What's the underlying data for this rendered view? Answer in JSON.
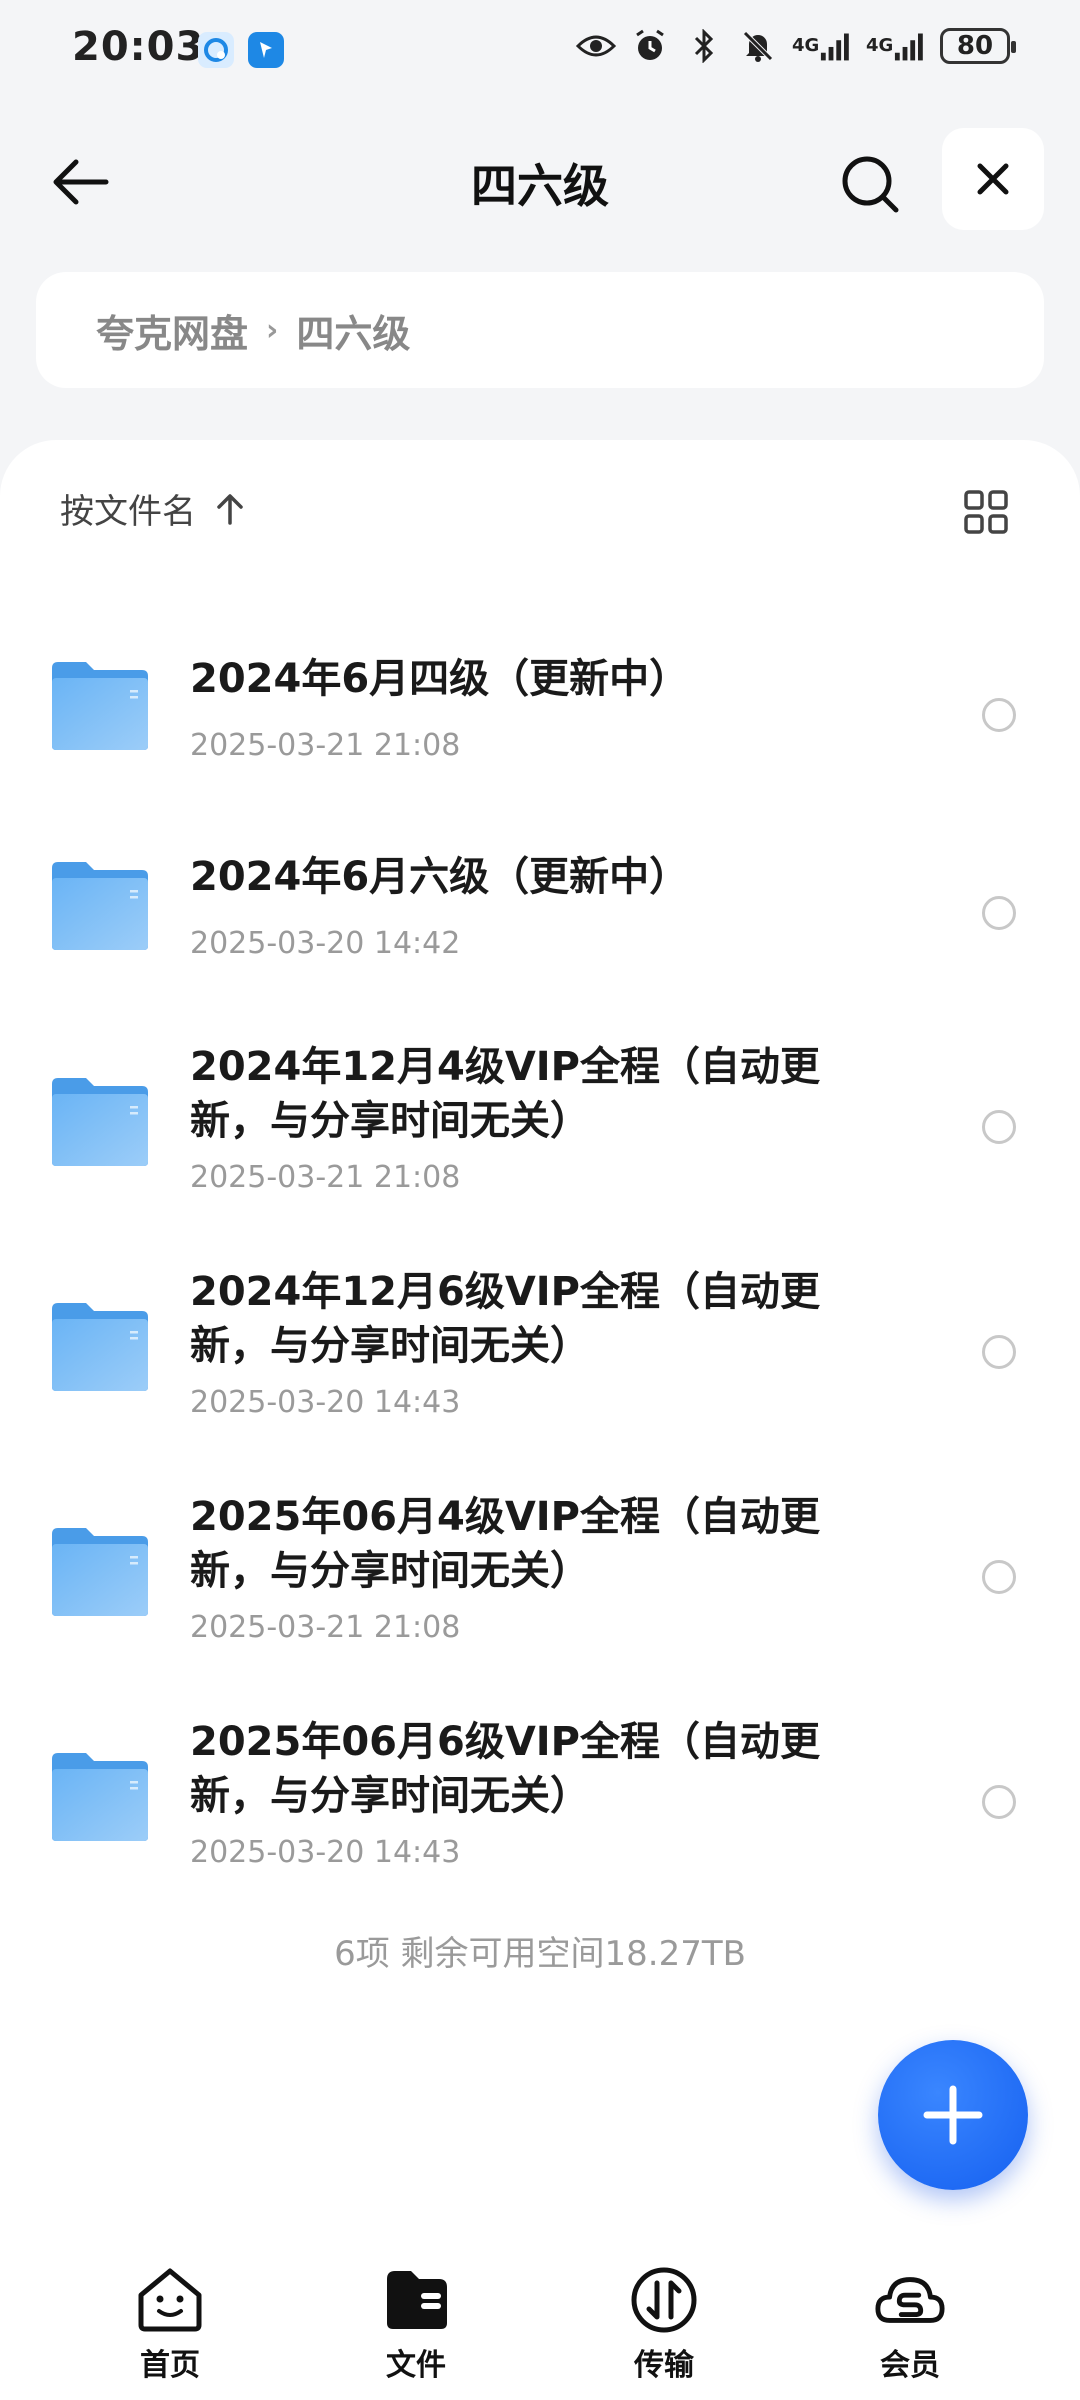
{
  "status_bar": {
    "time": "20:03",
    "network_1": "4G",
    "network_2": "4G",
    "battery": "80"
  },
  "header": {
    "title": "四六级"
  },
  "breadcrumb": {
    "root": "夸克网盘",
    "current": "四六级"
  },
  "sort": {
    "label": "按文件名"
  },
  "files": [
    {
      "name": "2024年6月四级（更新中）",
      "date": "2025-03-21 21:08"
    },
    {
      "name": "2024年6月六级（更新中）",
      "date": "2025-03-20 14:42"
    },
    {
      "name": "2024年12月4级VIP全程（自动更新，与分享时间无关）",
      "date": "2025-03-21 21:08"
    },
    {
      "name": "2024年12月6级VIP全程（自动更新，与分享时间无关）",
      "date": "2025-03-20 14:43"
    },
    {
      "name": "2025年06月4级VIP全程（自动更新，与分享时间无关）",
      "date": "2025-03-21 21:08"
    },
    {
      "name": "2025年06月6级VIP全程（自动更新，与分享时间无关）",
      "date": "2025-03-20 14:43"
    }
  ],
  "summary": "6项 剩余可用空间18.27TB",
  "bottom_nav": [
    {
      "label": "首页",
      "icon": "home-face-icon"
    },
    {
      "label": "文件",
      "icon": "folder-wallet-icon"
    },
    {
      "label": "传输",
      "icon": "transfer-icon"
    },
    {
      "label": "会员",
      "icon": "cloud-member-icon"
    }
  ],
  "colors": {
    "accent": "#1e6bf5",
    "folder": "#5aaaf0",
    "background": "#f4f5f7"
  }
}
